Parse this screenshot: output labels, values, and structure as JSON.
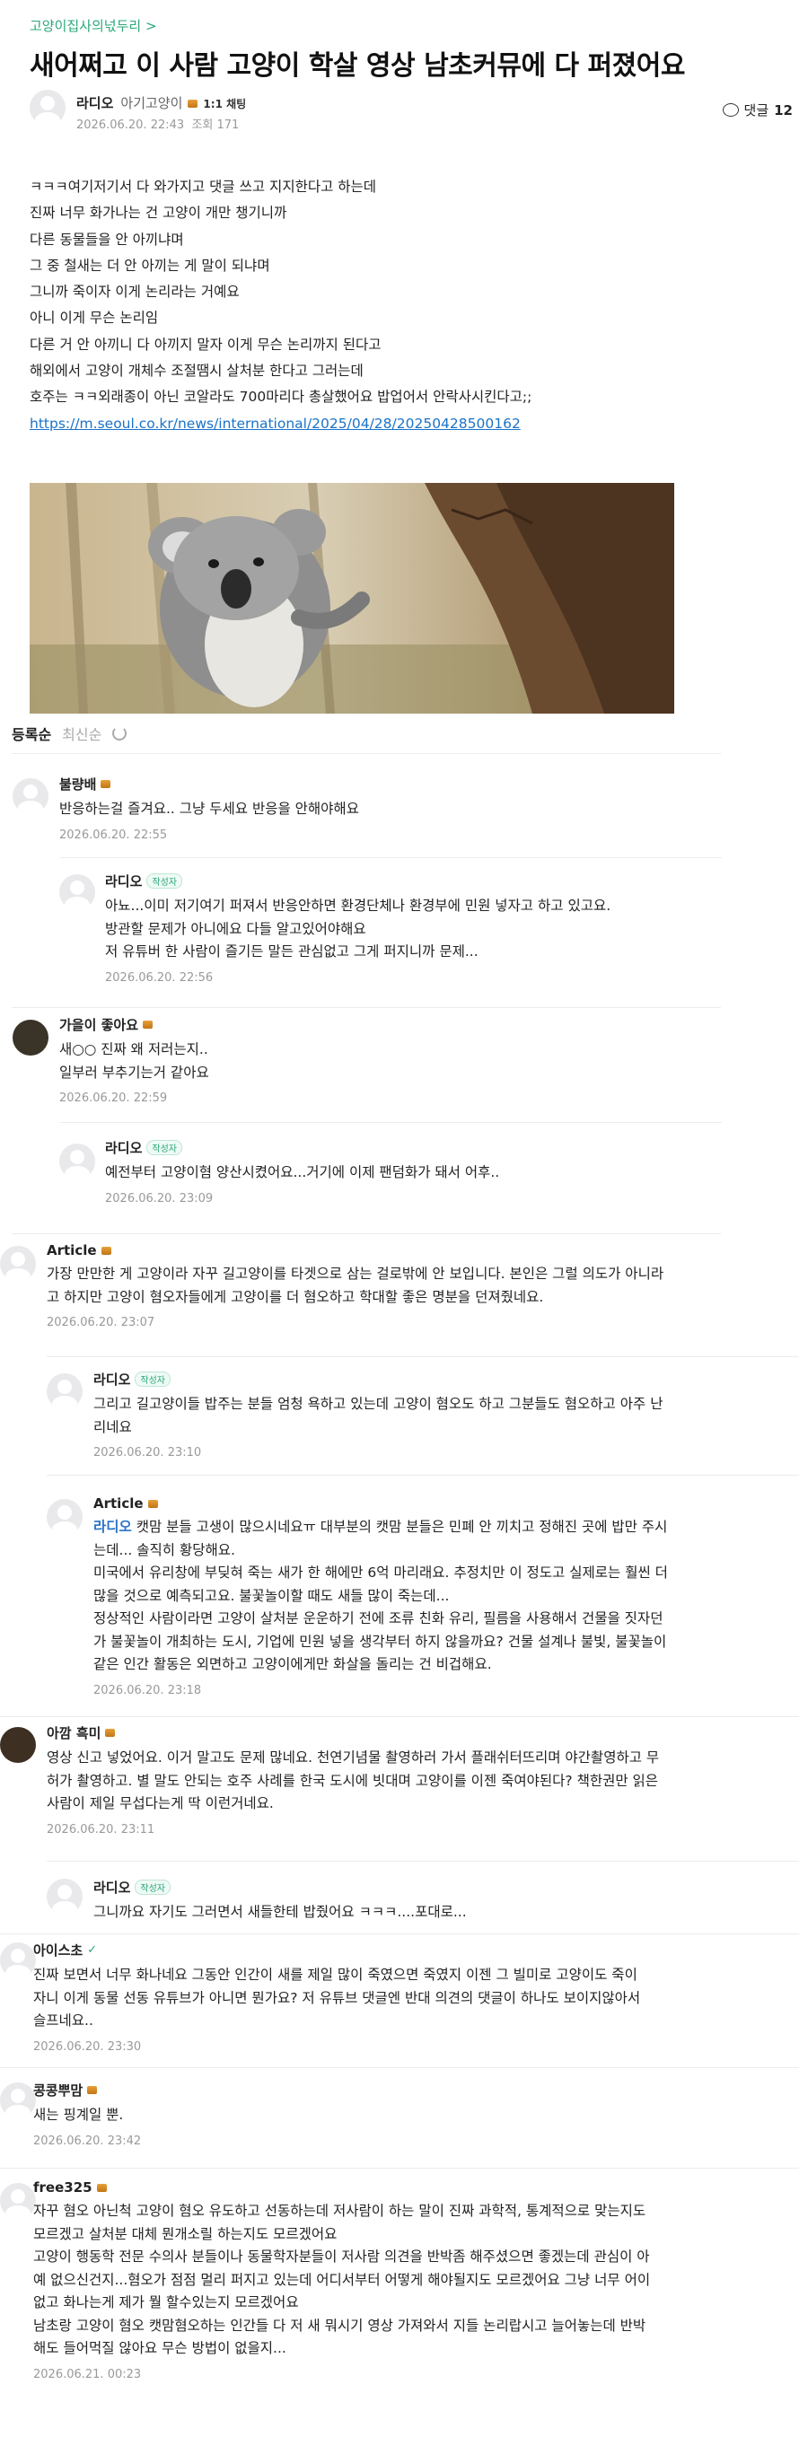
{
  "post": {
    "board": "고양이집사의넋두리 >",
    "title": "새어쩌고 이 사람 고양이 학살 영상 남초커뮤에 다 퍼졌어요",
    "author": "라디오",
    "level": "아기고양이",
    "chat_badge": "1:1 채팅",
    "datetime": "2026.06.20. 22:43",
    "views": "조회 171",
    "comment_label": "댓글",
    "comment_count": "12",
    "body": [
      "ㅋㅋㅋ여기저기서 다 와가지고 댓글 쓰고 지지한다고 하는데",
      "진짜 너무 화가나는 건 고양이 개만 챙기니까",
      "다른 동물들을 안 아끼냐며",
      "그 중 철새는 더 안 아끼는 게 말이 되냐며",
      "그니까 죽이자 이게 논리라는 거예요",
      "아니 이게 무슨 논리임",
      "다른 거 안 아끼니 다 아끼지 말자 이게 무슨 논리까지 된다고",
      "해외에서 고양이 개체수 조절땜시 살처분 한다고 그러는데",
      "호주는 ㅋㅋ외래종이 아닌 코알라도 700마리다 총살했어요 밥업어서 안락사시킨다고;;"
    ],
    "link": "https://m.seoul.co.kr/news/international/2025/04/28/20250428500162"
  },
  "sort": {
    "active": "등록순",
    "inactive": "최신순"
  },
  "comments": [
    {
      "name": "불량배",
      "lines": [
        "반응하는걸 즐겨요.. 그냥 두세요 반응을 안해야해요"
      ],
      "date": "2026.06.20. 22:55"
    },
    {
      "name": "라디오",
      "badge": "작성자",
      "lines": [
        "아뇨...이미 저기여기 퍼져서 반응안하면 환경단체나 환경부에 민원 넣자고 하고 있고요.",
        "방관할 문제가 아니에요 다들 알고있어야해요",
        "저 유튜버 한 사람이 즐기든 말든 관심없고 그게 퍼지니까 문제..."
      ],
      "date": "2026.06.20. 22:56"
    },
    {
      "name": "가을이 좋아요",
      "lines": [
        "새○○ 진짜 왜 저러는지..",
        "일부러 부추기는거 같아요"
      ],
      "date": "2026.06.20. 22:59"
    },
    {
      "name": "라디오",
      "badge": "작성자",
      "lines": [
        "예전부터 고양이혐 양산시켰어요...거기에 이제 팬덤화가 돼서 어후.."
      ],
      "date": "2026.06.20. 23:09"
    },
    {
      "name": "Article",
      "lines": [
        "가장 만만한 게 고양이라 자꾸 길고양이를 타겟으로 삼는 걸로밖에 안 보입니다. 본인은 그럴 의도가 아니라",
        "고 하지만 고양이 혐오자들에게 고양이를 더 혐오하고 학대할 좋은 명분을 던져줬네요."
      ],
      "date": "2026.06.20. 23:07"
    },
    {
      "name": "라디오",
      "badge": "작성자",
      "lines": [
        "그리고 길고양이들 밥주는 분들 엄청 욕하고 있는데 고양이 혐오도 하고 그분들도 혐오하고 아주 난",
        "리네요"
      ],
      "date": "2026.06.20. 23:10"
    },
    {
      "name": "Article",
      "mention": "라디오",
      "lines": [
        "캣맘 분들 고생이 많으시네요ㅠ 대부분의 캣맘 분들은 민폐 안 끼치고 정해진 곳에 밥만 주시",
        "는데... 솔직히 황당해요.",
        "미국에서 유리창에 부딪혀 죽는 새가 한 해에만 6억 마리래요. 추정치만 이 정도고 실제로는 훨씬 더",
        "많을 것으로 예측되고요. 불꽃놀이할 때도 새들 많이 죽는데...",
        "정상적인 사람이라면 고양이 살처분 운운하기 전에 조류 친화 유리, 필름을 사용해서 건물을 짓자던",
        "가 불꽃놀이 개최하는 도시, 기업에 민원 넣을 생각부터 하지 않을까요? 건물 설계나 불빛, 불꽃놀이",
        "같은 인간 활동은 외면하고 고양이에게만 화살을 돌리는 건 비겁해요."
      ],
      "date": "2026.06.20. 23:18"
    },
    {
      "name": "아깜 흑미",
      "lines": [
        "영상 신고 넣었어요. 이거 말고도 문제 많네요. 천연기념물 촬영하러 가서 플래쉬터뜨리며 야간촬영하고 무",
        "허가 촬영하고. 별 말도 안되는 호주 사례를 한국 도시에 빗대며 고양이를 이젠 죽여야된다? 책한권만 읽은",
        "사람이 제일 무섭다는게 딱 이런거네요."
      ],
      "date": "2026.06.20. 23:11"
    },
    {
      "name": "라디오",
      "badge": "작성자",
      "lines": [
        "그니까요 자기도 그러면서 새들한테 밥줬어요 ㅋㅋㅋ....포대로..."
      ],
      "date": ""
    },
    {
      "name": "아이스초",
      "verified": "✓",
      "lines": [
        "진짜 보면서 너무 화나네요 그동안 인간이 새를 제일 많이 죽였으면 죽였지 이젠 그 빌미로 고양이도 죽이",
        "자니 이게 동물 선동 유튜브가 아니면 뭔가요? 저 유튜브 댓글엔 반대 의견의 댓글이 하나도 보이지않아서",
        "슬프네요.."
      ],
      "date": "2026.06.20. 23:30"
    },
    {
      "name": "콩콩뿌맘",
      "lines": [
        "새는 핑계일 뿐."
      ],
      "date": "2026.06.20. 23:42"
    },
    {
      "name": "free325",
      "lines": [
        "자꾸 혐오 아닌척 고양이 혐오 유도하고 선동하는데 저사람이 하는 말이 진짜 과학적, 통계적으로 맞는지도",
        "모르겠고 살처분 대체 뭔개소릴 하는지도 모르겠어요",
        "고양이 행동학 전문 수의사 분들이나 동물학자분들이 저사람 의견을 반박좀 해주셨으면 좋겠는데 관심이 아",
        "예 없으신건지...혐오가 점점 멀리 퍼지고 있는데 어디서부터 어떻게 해야될지도 모르겠어요 그냥 너무 어이",
        "없고 화나는게 제가 뭘 할수있는지 모르겠어요",
        "남초랑 고양이 혐오 캣맘혐오하는 인간들 다 저 새 뭐시기 영상 가져와서 지들 논리랍시고 늘어놓는데 반박",
        "해도 들어먹질 않아요 무슨 방법이 없을지..."
      ],
      "date": "2026.06.21. 00:23"
    }
  ]
}
